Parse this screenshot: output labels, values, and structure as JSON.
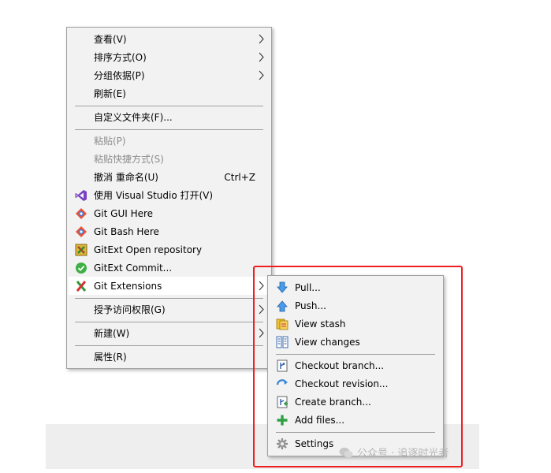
{
  "context_menu": {
    "items": [
      {
        "label": "查看(V)",
        "submenu": true
      },
      {
        "label": "排序方式(O)",
        "submenu": true
      },
      {
        "label": "分组依据(P)",
        "submenu": true
      },
      {
        "label": "刷新(E)"
      },
      {
        "label": "自定义文件夹(F)..."
      },
      {
        "label": "粘贴(P)",
        "disabled": true
      },
      {
        "label": "粘贴快捷方式(S)",
        "disabled": true
      },
      {
        "label": "撤消 重命名(U)",
        "shortcut": "Ctrl+Z"
      },
      {
        "label": "使用 Visual Studio 打开(V)",
        "icon": "visual-studio-icon"
      },
      {
        "label": "Git GUI Here",
        "icon": "git-gui-icon"
      },
      {
        "label": "Git Bash Here",
        "icon": "git-bash-icon"
      },
      {
        "label": "GitExt Open repository",
        "icon": "gitext-open-repo-icon"
      },
      {
        "label": "GitExt Commit...",
        "icon": "gitext-commit-icon"
      },
      {
        "label": "Git Extensions",
        "icon": "git-extensions-icon",
        "submenu": true
      },
      {
        "label": "授予访问权限(G)",
        "submenu": true
      },
      {
        "label": "新建(W)",
        "submenu": true
      },
      {
        "label": "属性(R)"
      }
    ]
  },
  "git_extensions_submenu": {
    "items": [
      {
        "label": "Pull...",
        "icon": "pull-icon"
      },
      {
        "label": "Push...",
        "icon": "push-icon"
      },
      {
        "label": "View stash",
        "icon": "stash-icon"
      },
      {
        "label": "View changes",
        "icon": "view-changes-icon"
      },
      {
        "label": "Checkout branch...",
        "icon": "checkout-branch-icon"
      },
      {
        "label": "Checkout revision...",
        "icon": "checkout-revision-icon"
      },
      {
        "label": "Create branch...",
        "icon": "create-branch-icon"
      },
      {
        "label": "Add files...",
        "icon": "add-files-icon"
      },
      {
        "label": "Settings",
        "icon": "settings-icon"
      }
    ]
  },
  "watermark": {
    "text": "公众号 · 追逐时光者"
  },
  "colors": {
    "highlight_box": "#ee2020",
    "menu_bg": "#f2f2f2",
    "disabled_text": "#8d8d8d"
  }
}
